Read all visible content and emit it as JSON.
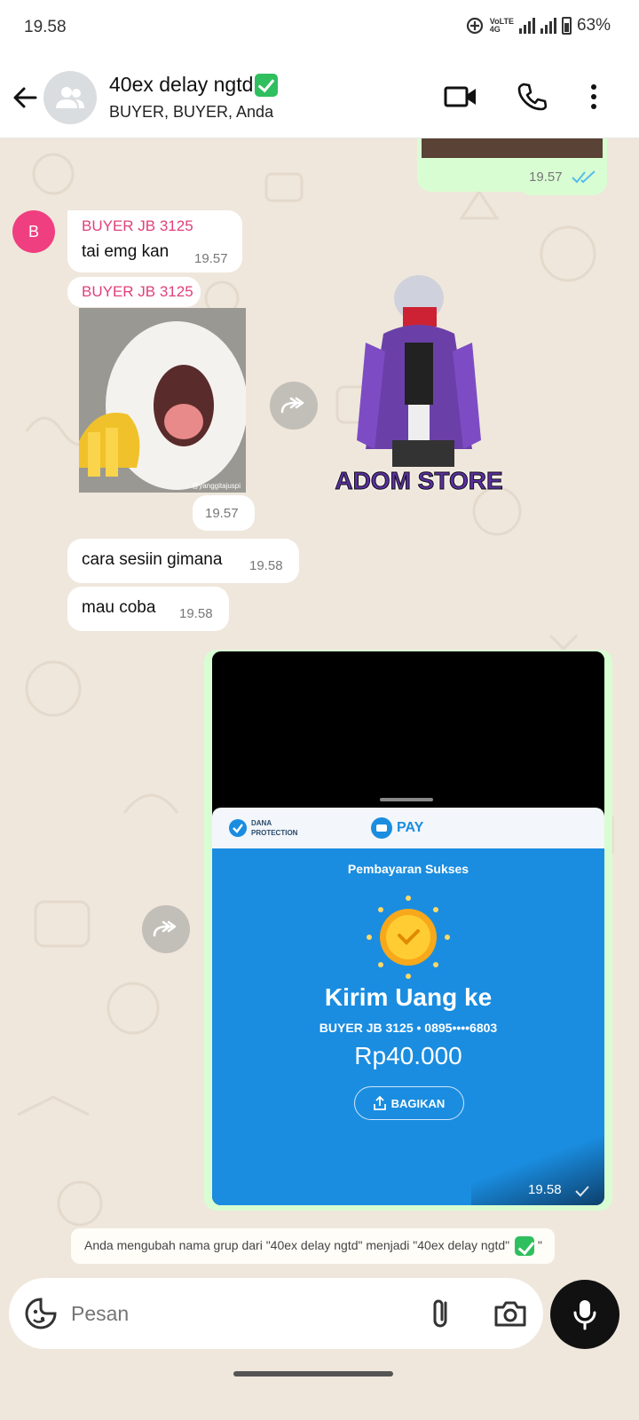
{
  "status_bar": {
    "time": "19.58",
    "network": "VoLTE 4G",
    "battery": "63%"
  },
  "header": {
    "title": "40ex delay ngtd",
    "subtitle": "BUYER, BUYER, Anda",
    "icons": [
      "back-arrow-icon",
      "group-avatar-icon",
      "video-call-icon",
      "phone-icon",
      "more-icon"
    ]
  },
  "messages": {
    "out_first_time": "19.57",
    "sender_initial": "B",
    "msg1": {
      "sender": "BUYER JB 3125",
      "text": "tai emg kan",
      "time": "19.57"
    },
    "msg2": {
      "sender": "BUYER JB 3125",
      "time": "19.57",
      "sticker_caption": "@yanggitajuspi"
    },
    "sticker_text": "ADOM STORE",
    "msg3": {
      "text": "cara sesiin gimana",
      "time": "19.58"
    },
    "msg4": {
      "text": "mau coba",
      "time": "19.58"
    },
    "receipt": {
      "brand_left": "DANA",
      "brand_left_sub": "PROTECTION",
      "brand_center": "PAY",
      "status": "Pembayaran Sukses",
      "title": "Kirim Uang ke",
      "recipient": "BUYER JB 3125 • 0895••••6803",
      "amount": "Rp40.000",
      "share_label": "BAGIKAN",
      "time": "19.58"
    },
    "system_note": "Anda mengubah nama grup dari \"40ex delay ngtd\" menjadi \"40ex delay ngtd\""
  },
  "input": {
    "placeholder": "Pesan"
  },
  "colors": {
    "sender": "#e0407a",
    "outgoing": "#d9fdd3",
    "dana_blue": "#1a8de0",
    "read_tick": "#53bdeb"
  }
}
